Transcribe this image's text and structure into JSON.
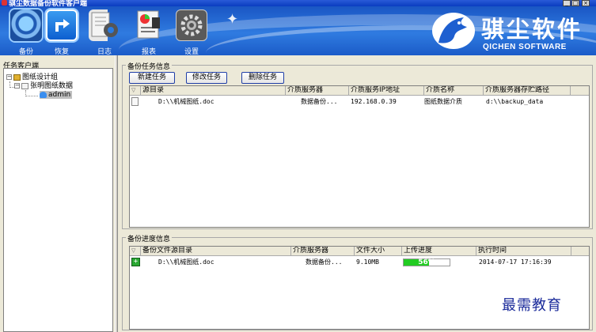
{
  "window": {
    "title": "骐尘数据备份软件客户端",
    "buttons": [
      "_",
      "□",
      "×"
    ]
  },
  "toolbar": {
    "items": [
      {
        "label": "备份",
        "icon": "backup-icon",
        "active": true
      },
      {
        "label": "恢复",
        "icon": "restore-icon",
        "active": true
      },
      {
        "label": "日志",
        "icon": "log-icon",
        "active": false
      },
      {
        "label": "报表",
        "icon": "report-icon",
        "active": false
      },
      {
        "label": "设置",
        "icon": "settings-icon",
        "active": false
      }
    ]
  },
  "brand": {
    "name_cn": "骐尘软件",
    "name_en": "QICHEN SOFTWARE",
    "logo_icon": "horse-logo-icon"
  },
  "left_panel": {
    "title": "任务客户端",
    "tree": {
      "root": "图纸设计组",
      "child": "张明图纸数据",
      "leaf": "admin"
    }
  },
  "task_panel": {
    "title": "备份任务信息",
    "buttons": {
      "new": "新建任务",
      "edit": "修改任务",
      "delete": "删除任务"
    },
    "columns": [
      "源目录",
      "介质服务器",
      "介质服务IP地址",
      "介质名称",
      "介质服务器存贮路径"
    ],
    "rows": [
      {
        "source": "D:\\\\机械图纸.doc",
        "server": "数据备份...",
        "ip": "192.168.0.39",
        "media": "图纸数据介质",
        "path": "d:\\\\backup_data"
      }
    ]
  },
  "progress_panel": {
    "title": "备份进度信息",
    "columns": [
      "备份文件源目录",
      "介质服务器",
      "文件大小",
      "上传进度",
      "执行时间"
    ],
    "rows": [
      {
        "source": "D:\\\\机械图纸.doc",
        "server": "数据备份...",
        "size": "9.10MB",
        "progress_pct": 56,
        "progress_label": "56%",
        "time": "2014-07-17 17:16:39"
      }
    ]
  },
  "watermark": "最需教育",
  "colors": {
    "banner": "#2f7be0",
    "progress": "#22cc22",
    "button_border": "#1f3ea6"
  }
}
